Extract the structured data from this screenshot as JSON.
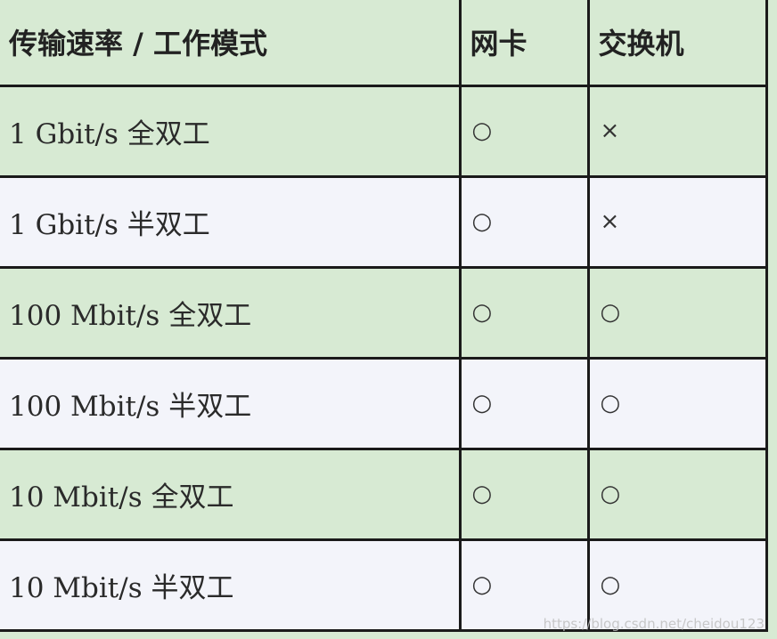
{
  "table": {
    "headers": [
      "传输速率 / 工作模式",
      "网卡",
      "交换机"
    ],
    "rows": [
      {
        "mode": "1 Gbit/s 全双工",
        "nic": "○",
        "switch": "×"
      },
      {
        "mode": "1 Gbit/s 半双工",
        "nic": "○",
        "switch": "×"
      },
      {
        "mode": "100 Mbit/s 全双工",
        "nic": "○",
        "switch": "○"
      },
      {
        "mode": "100 Mbit/s 半双工",
        "nic": "○",
        "switch": "○"
      },
      {
        "mode": "10 Mbit/s 全双工",
        "nic": "○",
        "switch": "○"
      },
      {
        "mode": "10 Mbit/s 半双工",
        "nic": "○",
        "switch": "○"
      }
    ]
  },
  "watermark": "https://blog.csdn.net/cheidou123",
  "colors": {
    "row_green": "#d7ead3",
    "row_white": "#f3f4fa",
    "border": "#1a1a1a"
  }
}
